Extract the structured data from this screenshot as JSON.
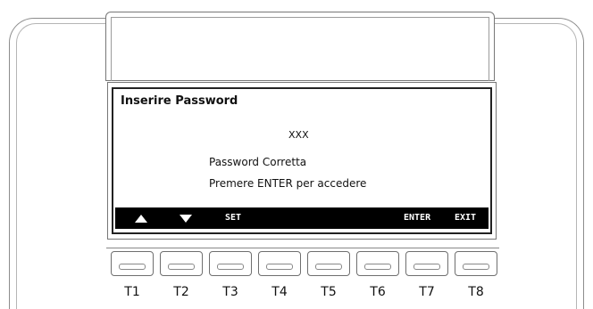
{
  "lcd": {
    "title": "Inserire Password",
    "code": "XXX",
    "line1": "Password Corretta",
    "line2": "Premere ENTER per accedere"
  },
  "softkeys": {
    "up_icon": "arrow-up-icon",
    "down_icon": "arrow-down-icon",
    "set": "SET",
    "enter": "ENTER",
    "exit": "EXIT"
  },
  "keys": [
    "T1",
    "T2",
    "T3",
    "T4",
    "T5",
    "T6",
    "T7",
    "T8"
  ]
}
